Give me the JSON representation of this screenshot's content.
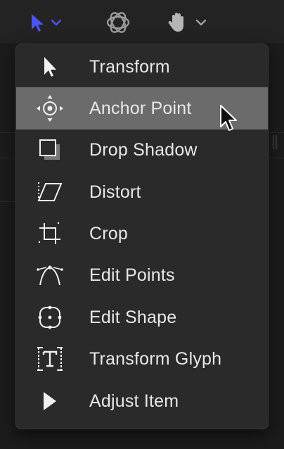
{
  "toolbar": {
    "select_tool_icon": "arrow-pointer-icon",
    "orbit_tool_icon": "orbit-icon",
    "pan_tool_icon": "hand-icon",
    "accent": "#4a55ff"
  },
  "menu": {
    "items": [
      {
        "label": "Transform",
        "icon": "arrow-pointer-icon"
      },
      {
        "label": "Anchor Point",
        "icon": "anchor-point-icon",
        "highlighted": true
      },
      {
        "label": "Drop Shadow",
        "icon": "drop-shadow-icon"
      },
      {
        "label": "Distort",
        "icon": "distort-icon"
      },
      {
        "label": "Crop",
        "icon": "crop-icon"
      },
      {
        "label": "Edit Points",
        "icon": "edit-points-icon"
      },
      {
        "label": "Edit Shape",
        "icon": "edit-shape-icon"
      },
      {
        "label": "Transform Glyph",
        "icon": "transform-glyph-icon"
      },
      {
        "label": "Adjust Item",
        "icon": "adjust-item-icon"
      }
    ],
    "highlight_color": "#6b6b6b"
  }
}
